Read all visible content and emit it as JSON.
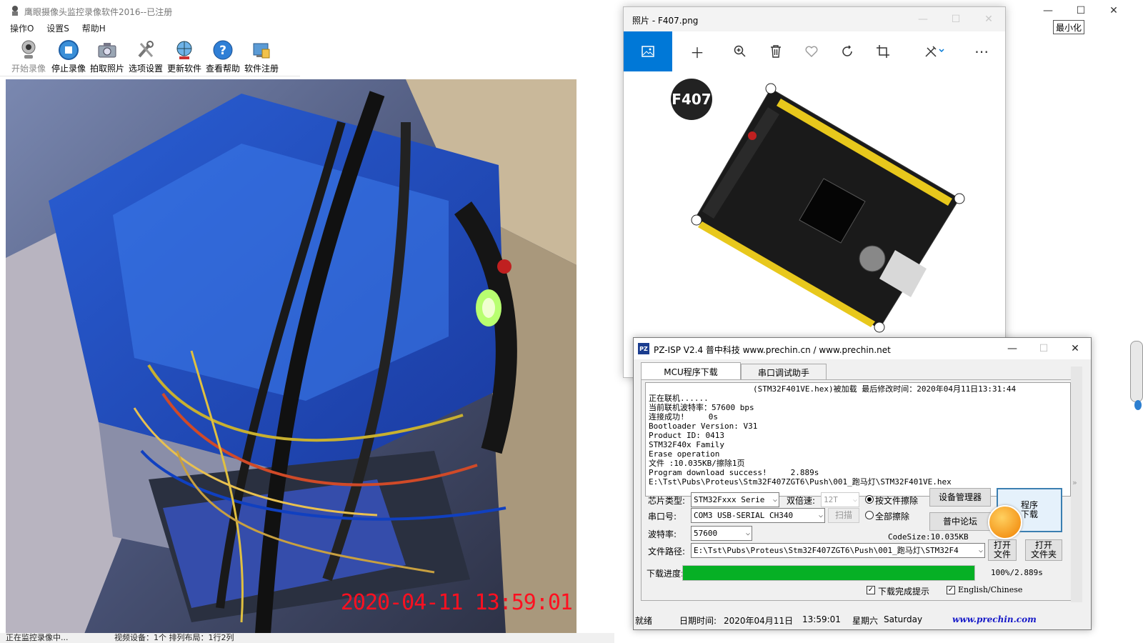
{
  "camera_app": {
    "title": "鹰眼摄像头监控录像软件2016--已注册",
    "menu": [
      "操作O",
      "设置S",
      "帮助H"
    ],
    "toolbar": [
      {
        "label": "开始录像",
        "icon": "webcam-icon",
        "enabled": false
      },
      {
        "label": "停止录像",
        "icon": "stop-icon",
        "enabled": true
      },
      {
        "label": "拍取照片",
        "icon": "camera-icon",
        "enabled": true
      },
      {
        "label": "选项设置",
        "icon": "tools-icon",
        "enabled": true
      },
      {
        "label": "更新软件",
        "icon": "update-globe-icon",
        "enabled": true
      },
      {
        "label": "查看帮助",
        "icon": "help-icon",
        "enabled": true
      },
      {
        "label": "软件注册",
        "icon": "register-icon",
        "enabled": true
      }
    ],
    "feed_timestamp": "2020-04-11 13:59:01",
    "status": {
      "left": "正在监控录像中...",
      "middle": "视频设备：1个 排列布局：1行2列"
    },
    "minimize_tooltip": "最小化"
  },
  "photos_app": {
    "title": "照片 - F407.png",
    "toolbar_icons": [
      "image-view-icon",
      "add-icon",
      "zoom-in-icon",
      "delete-icon",
      "favorite-icon",
      "rotate-icon",
      "crop-icon",
      "edit-icon",
      "more-icon"
    ],
    "image_badge": "F407"
  },
  "isp_app": {
    "title": "PZ-ISP V2.4 普中科技  www.prechin.cn / www.prechin.net",
    "tabs": [
      "MCU程序下载",
      "串口调试助手"
    ],
    "log_header": "(STM32F401VE.hex)被加载 最后修改时间：2020年04月11日13:31:44",
    "log_lines": [
      "正在联机......",
      "当前联机波特率：57600 bps",
      "连接成功!     0s",
      "Bootloader Version: V31",
      "Product ID: 0413",
      "STM32F40x Family",
      "Erase operation",
      "文件 :10.035KB/擦除1页",
      "Program download success!     2.889s",
      "E:\\Tst\\Pubs\\Proteus\\Stm32F407ZGT6\\Push\\001_跑马灯\\STM32F401VE.hex"
    ],
    "labels": {
      "chip_type": "芯片类型:",
      "double_speed": "双倍速:",
      "port": "串口号:",
      "baud": "波特率:",
      "file_path": "文件路径:",
      "progress": "下载进度:",
      "code_size": "CodeSize:10.035KB"
    },
    "fields": {
      "chip_type": "STM32Fxxx Serie",
      "double_speed": "12T",
      "port": "COM3  USB-SERIAL CH340",
      "baud": "57600",
      "file_path": "E:\\Tst\\Pubs\\Proteus\\Stm32F407ZGT6\\Push\\001_跑马灯\\STM32F4"
    },
    "erase_options": {
      "by_file": "按文件擦除",
      "all": "全部擦除",
      "selected": "by_file"
    },
    "buttons": {
      "scan": "扫描",
      "device_manager": "设备管理器",
      "forum": "普中论坛",
      "program": "程序\n下载",
      "open_file": "打开\n文件",
      "open_folder": "打开\n文件夹"
    },
    "progress_text": "100%/2.889s",
    "progress_fraction": 1.0,
    "checks": {
      "done_prompt": "下载完成提示",
      "lang": "English/Chinese"
    },
    "status": {
      "state": "就绪",
      "date_label": "日期时间:",
      "date": "2020年04月11日",
      "time": "13:59:01",
      "weekday": "星期六",
      "weekday_en": "Saturday",
      "site": "www.prechin.com"
    }
  }
}
